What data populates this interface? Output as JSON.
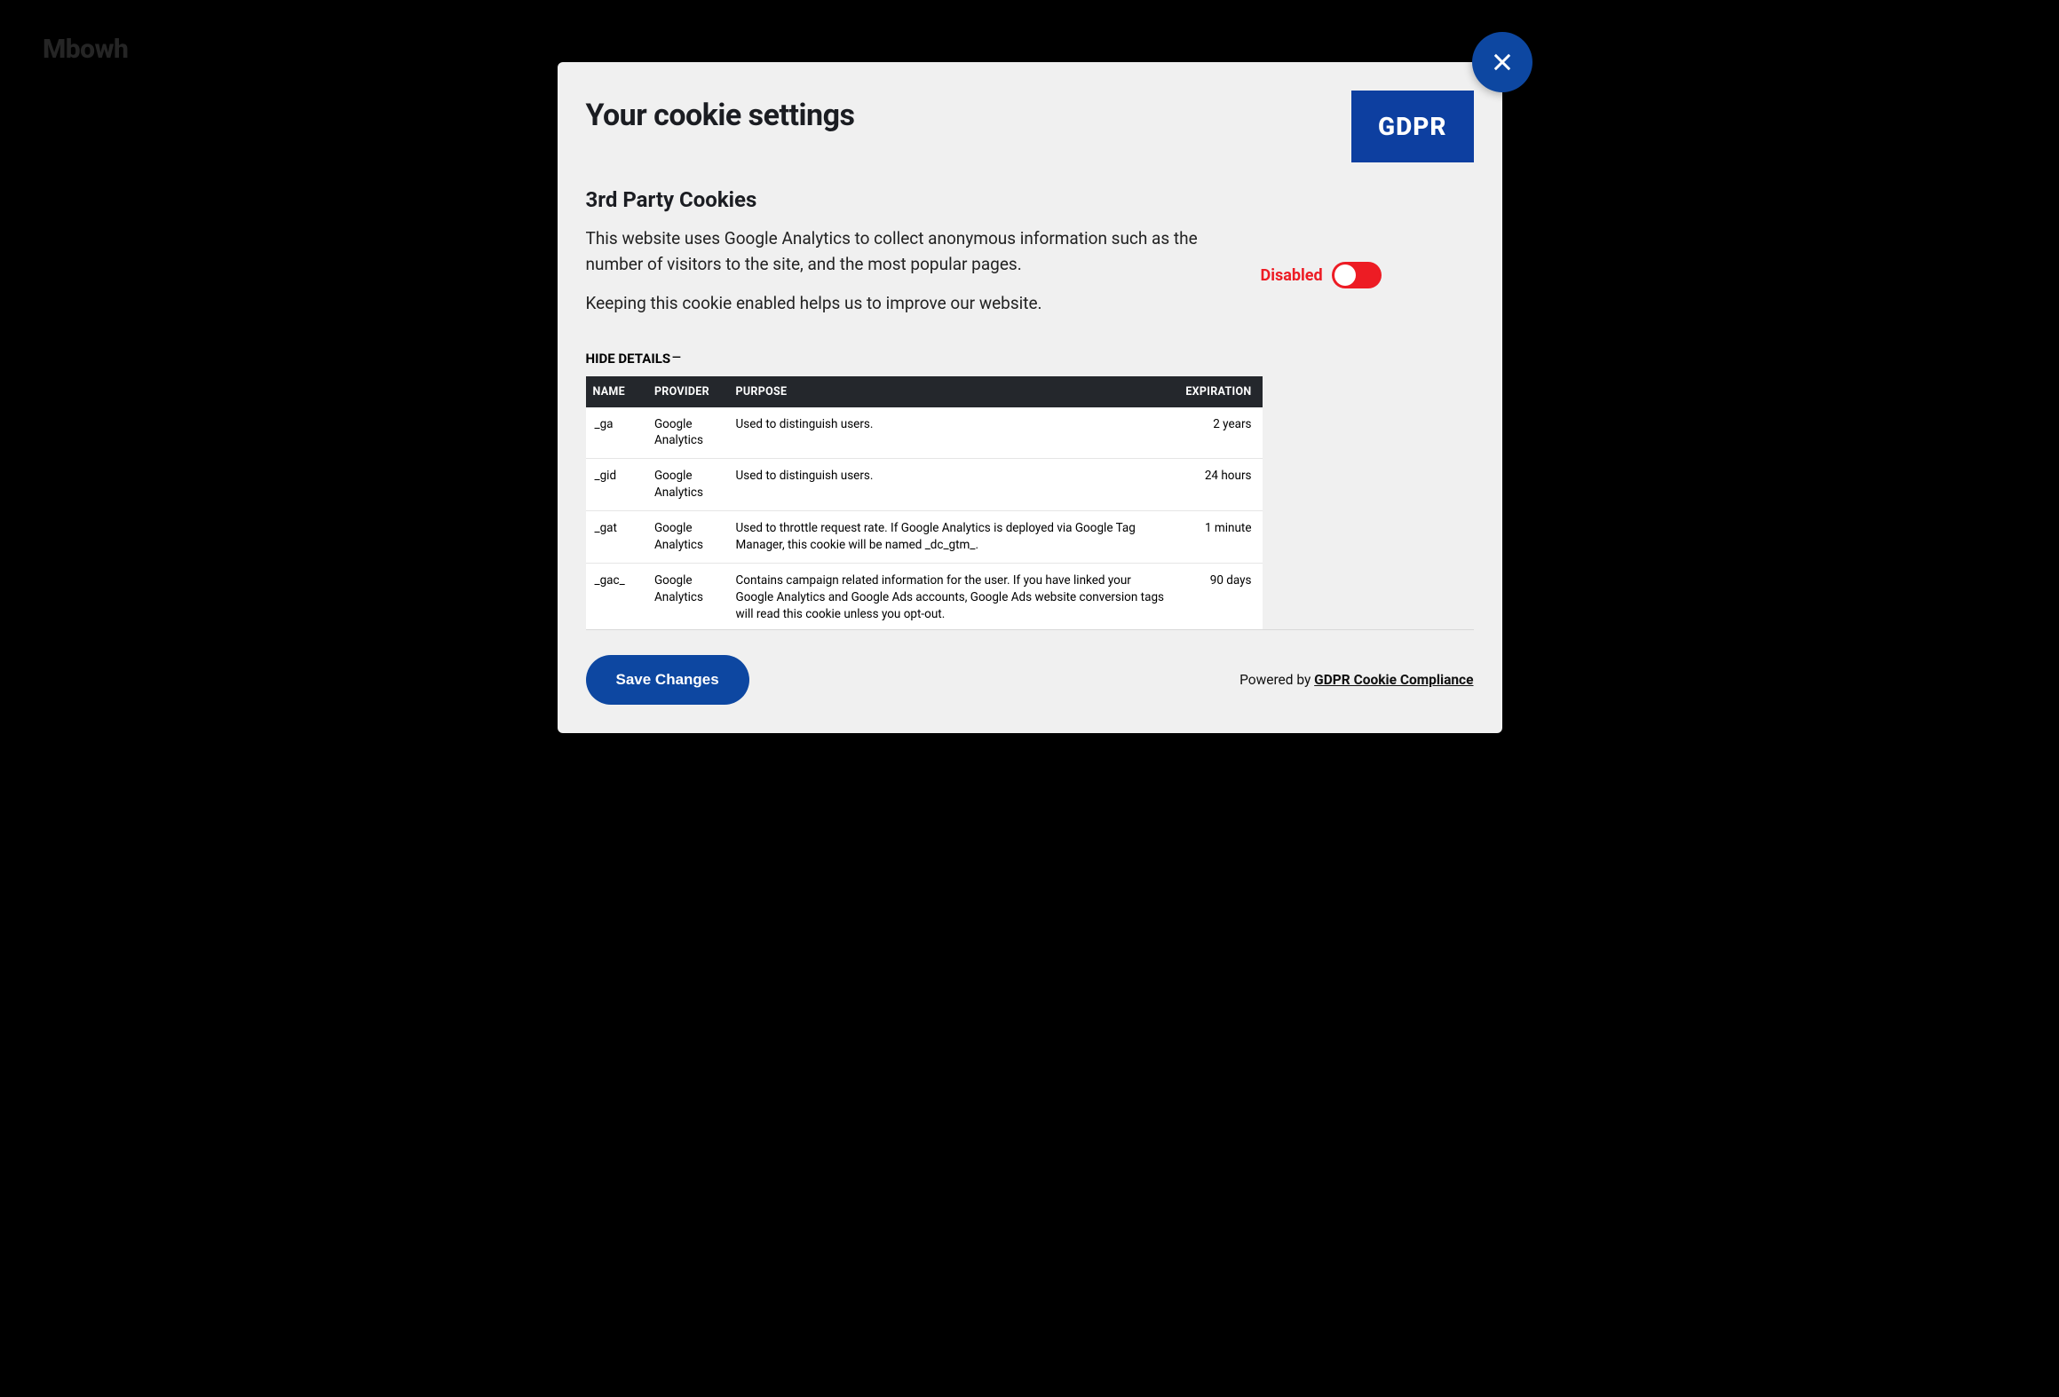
{
  "background": {
    "logo_text": "Mbowh"
  },
  "modal": {
    "title": "Your cookie settings",
    "badge": "GDPR",
    "section": {
      "heading": "3rd Party Cookies",
      "para1": "This website uses Google Analytics to collect anonymous information such as the number of visitors to the site, and the most popular pages.",
      "para2": "Keeping this cookie enabled helps us to improve our website.",
      "toggle_state_label": "Disabled",
      "toggle_value": false
    },
    "details_toggle_label": "HIDE DETAILS",
    "table": {
      "headers": {
        "name": "NAME",
        "provider": "PROVIDER",
        "purpose": "PURPOSE",
        "expiration": "EXPIRATION"
      },
      "rows": [
        {
          "name": "_ga",
          "provider": "Google Analytics",
          "purpose": "Used to distinguish users.",
          "expiration": "2 years"
        },
        {
          "name": "_gid",
          "provider": "Google Analytics",
          "purpose": "Used to distinguish users.",
          "expiration": "24 hours"
        },
        {
          "name": "_gat",
          "provider": "Google Analytics",
          "purpose": "Used to throttle request rate. If Google Analytics is deployed via Google Tag Manager, this cookie will be named _dc_gtm_.",
          "expiration": "1 minute"
        },
        {
          "name": "_gac_",
          "provider": "Google Analytics",
          "purpose": "Contains campaign related information for the user. If you have linked your Google Analytics and Google Ads accounts, Google Ads website conversion tags will read this cookie unless you opt-out.",
          "expiration": "90 days"
        }
      ]
    },
    "footer": {
      "save_label": "Save Changes",
      "powered_prefix": "Powered by ",
      "powered_link": "GDPR Cookie Compliance"
    }
  }
}
